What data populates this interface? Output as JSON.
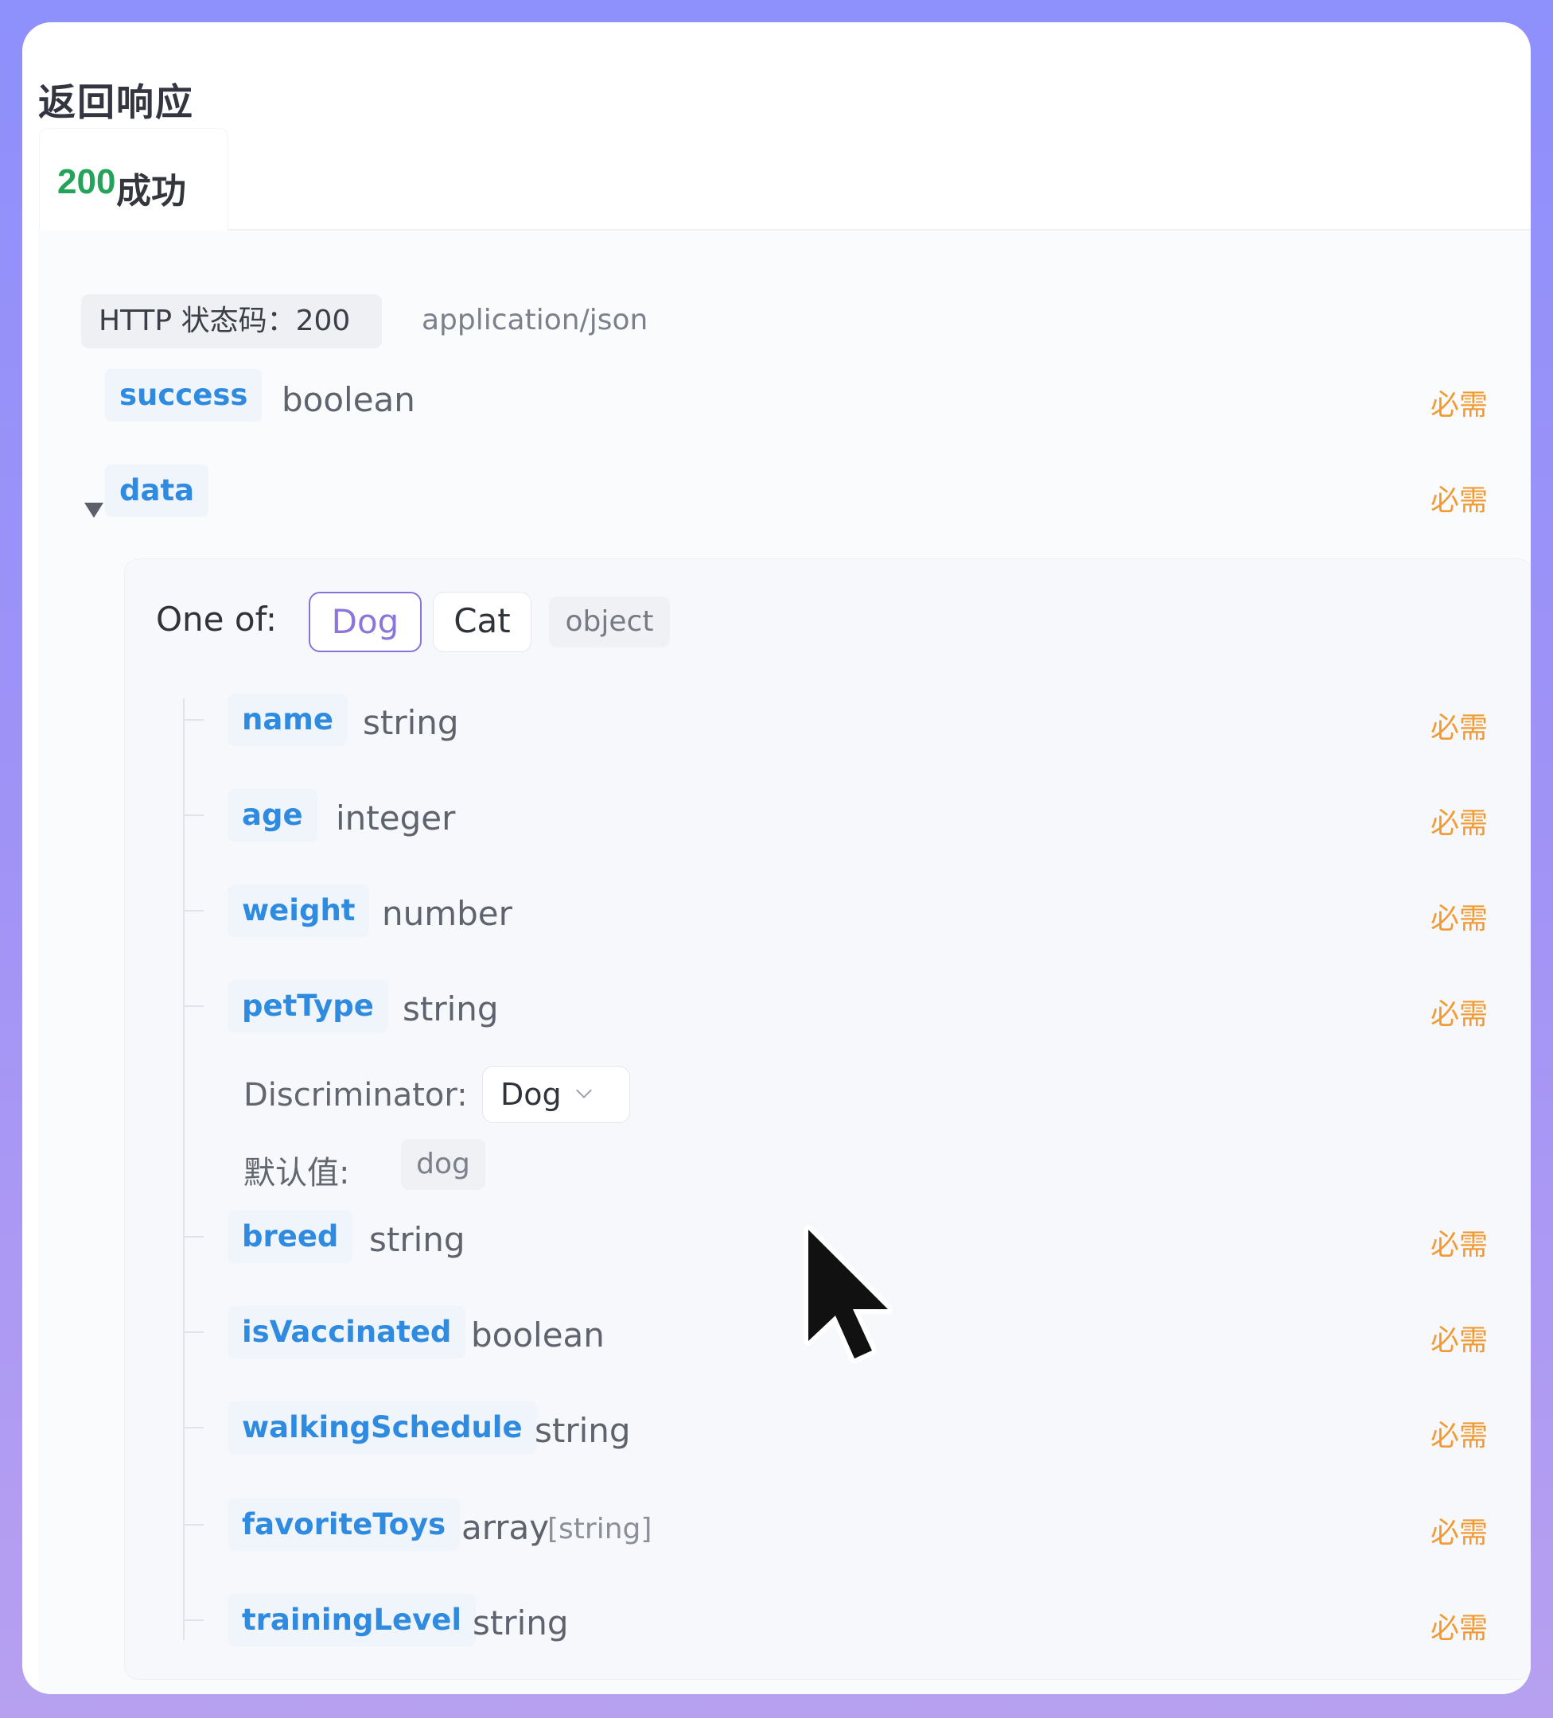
{
  "title": "返回响应",
  "tab": {
    "code": "200",
    "label": "成功"
  },
  "http_badge": "HTTP 状态码：200",
  "content_type": "application/json",
  "required_label": "必需",
  "top_fields": [
    {
      "name": "success",
      "type": "boolean"
    },
    {
      "name": "data",
      "type": ""
    }
  ],
  "one_of": {
    "label": "One of:",
    "options": [
      "Dog",
      "Cat"
    ],
    "selected": "Dog",
    "type_badge": "object"
  },
  "dog_fields": [
    {
      "name": "name",
      "type": "string"
    },
    {
      "name": "age",
      "type": "integer"
    },
    {
      "name": "weight",
      "type": "number"
    },
    {
      "name": "petType",
      "type": "string"
    },
    {
      "name": "breed",
      "type": "string"
    },
    {
      "name": "isVaccinated",
      "type": "boolean"
    },
    {
      "name": "walkingSchedule",
      "type": "string"
    },
    {
      "name": "favoriteToys",
      "type": "array",
      "subtype": "[string]"
    },
    {
      "name": "trainingLevel",
      "type": "string"
    }
  ],
  "discriminator": {
    "label": "Discriminator:",
    "value": "Dog"
  },
  "default_value": {
    "label": "默认值:",
    "value": "dog"
  },
  "icons": {
    "caret": "caret-down-icon",
    "chevron": "chevron-down-icon",
    "cursor": "mouse-cursor-icon"
  }
}
